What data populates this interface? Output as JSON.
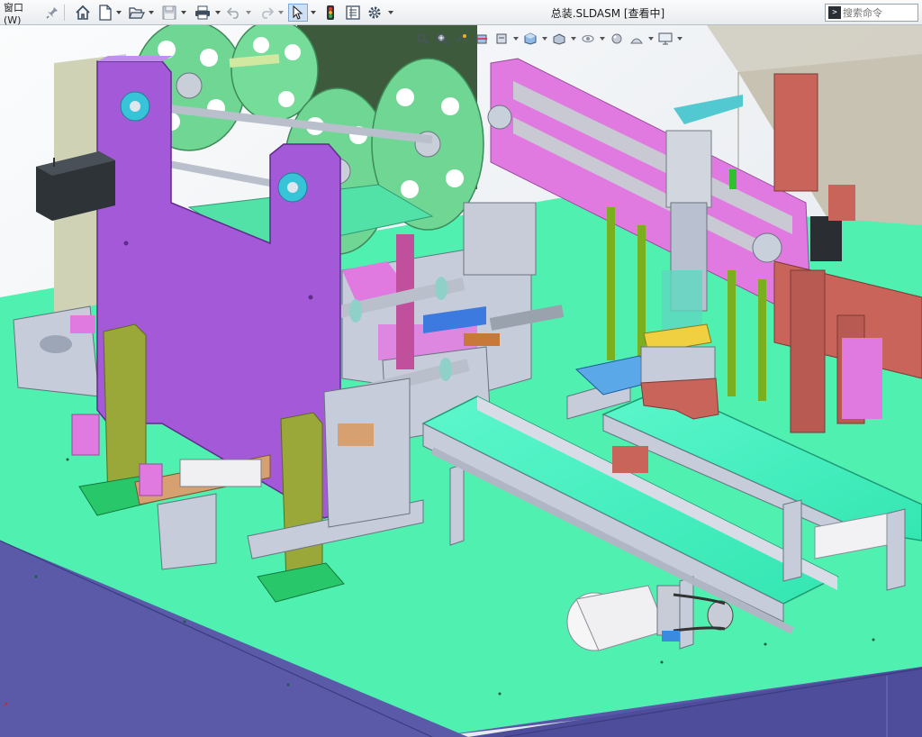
{
  "app": {
    "menu_window": "窗口(W)",
    "document_title": "总装.SLDASM [查看中]"
  },
  "search": {
    "placeholder": "搜索命令",
    "prompt_glyph": ">"
  },
  "toolbar": {
    "items": [
      "pin-icon",
      "home-icon",
      "new-document-icon",
      "open-file-icon",
      "save-icon",
      "print-icon",
      "undo-icon",
      "redo-icon",
      "select-cursor-icon",
      "traffic-light-icon",
      "file-properties-icon",
      "options-gear-icon"
    ]
  },
  "heads_up_toolbar": {
    "items": [
      "zoom-to-fit-icon",
      "zoom-to-area-icon",
      "previous-view-icon",
      "section-view-icon",
      "dynamic-annotation-icon",
      "view-orientation-icon",
      "display-style-icon",
      "hide-show-icon",
      "edit-appearance-icon",
      "apply-scene-icon",
      "view-settings-icon"
    ]
  },
  "colors": {
    "table_top": "#4ff0b0",
    "table_side": "#5858a8",
    "purple_plate": "#a45ad8",
    "reel_green": "#6fd694",
    "conveyor_belt": "#44f3c0",
    "frame_gray": "#c6ccda",
    "magenta": "#e07ae0",
    "rust_red": "#c8645a",
    "olive": "#9aa83a",
    "steel_blue": "#74a8d8"
  }
}
